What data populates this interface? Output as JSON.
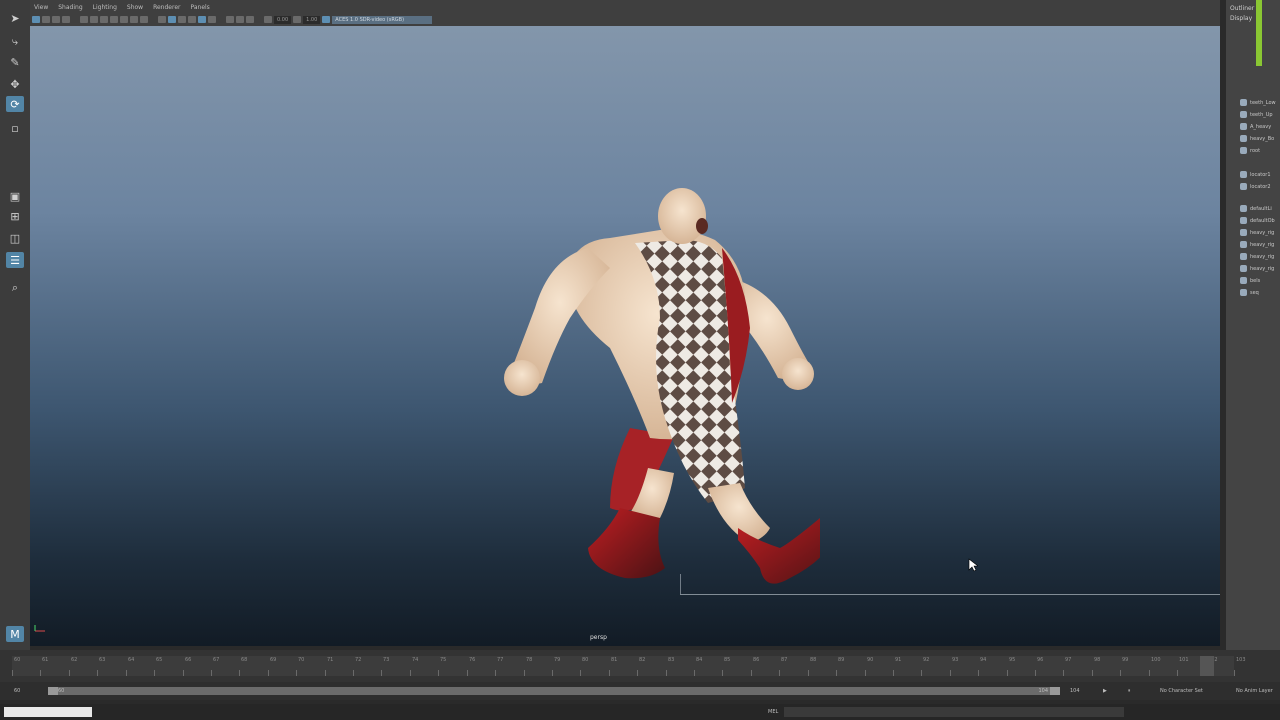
{
  "panel_menu": [
    "View",
    "Shading",
    "Lighting",
    "Show",
    "Renderer",
    "Panels"
  ],
  "panel_toolbar": {
    "field1": "0.00",
    "field2": "1.00",
    "color_space": "ACES 1.0 SDR-video (sRGB)"
  },
  "viewport": {
    "camera_label": "persp"
  },
  "outliner": {
    "tabs": [
      "Outliner",
      "Display"
    ],
    "items": [
      "teeth_Low",
      "teeth_Up",
      "A_heavy",
      "heavy_Bo",
      "root",
      "locator1",
      "locator2",
      "defaultLi",
      "defaultOb",
      "heavy_rig",
      "heavy_rig",
      "heavy_rig",
      "heavy_rig",
      "bels",
      "seq"
    ]
  },
  "time_slider": {
    "start_frame": "60",
    "end_frame": "102",
    "current_frame": "102",
    "tick_labels": [
      "60",
      "61",
      "62",
      "63",
      "64",
      "65",
      "66",
      "67",
      "68",
      "69",
      "70",
      "71",
      "72",
      "73",
      "74",
      "75",
      "76",
      "77",
      "78",
      "79",
      "80",
      "81",
      "82",
      "83",
      "84",
      "85",
      "86",
      "87",
      "88",
      "89",
      "90",
      "91",
      "92",
      "93",
      "94",
      "95",
      "96",
      "97",
      "98",
      "99",
      "100",
      "101",
      "102",
      "103"
    ]
  },
  "range_slider": {
    "anim_start": "60",
    "playback_start": "60",
    "playback_end": "104",
    "anim_end": "104",
    "character_set": "No Character Set",
    "anim_layer": "No Anim Layer"
  },
  "command_line": {
    "language": "MEL"
  },
  "colors": {
    "accent": "#5285a6",
    "outliner_accent": "#8ac733"
  }
}
